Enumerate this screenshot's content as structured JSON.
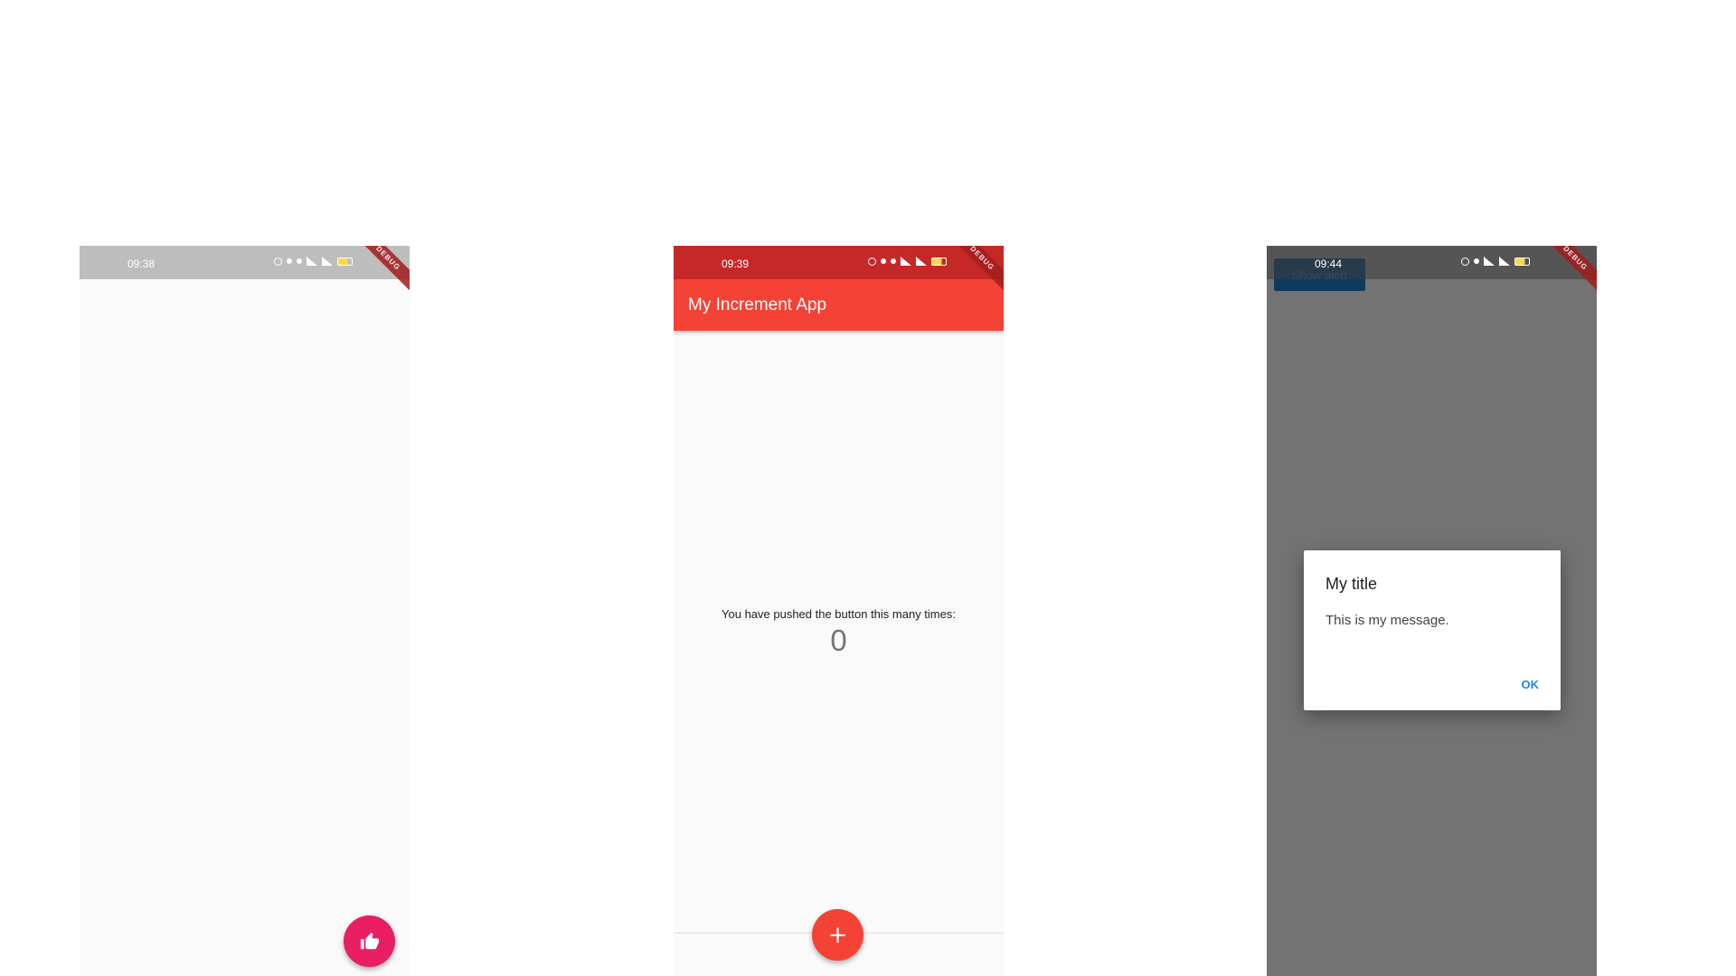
{
  "screens": [
    {
      "status": {
        "time": "09:38"
      },
      "debug_label": "DEBUG",
      "fab_icon": "thumb-up-icon"
    },
    {
      "status": {
        "time": "09:39"
      },
      "debug_label": "DEBUG",
      "appbar_title": "My Increment App",
      "counter_label": "You have pushed the button this many times:",
      "counter_value": "0",
      "fab_label": "+"
    },
    {
      "status": {
        "time": "09:44"
      },
      "debug_label": "DEBUG",
      "show_alert_label": "Show alert",
      "dialog": {
        "title": "My title",
        "message": "This is my message.",
        "ok_label": "OK"
      }
    }
  ],
  "colors": {
    "primary_red": "#f44336",
    "pink_accent": "#e91e63",
    "dialog_action": "#1e88e5"
  }
}
